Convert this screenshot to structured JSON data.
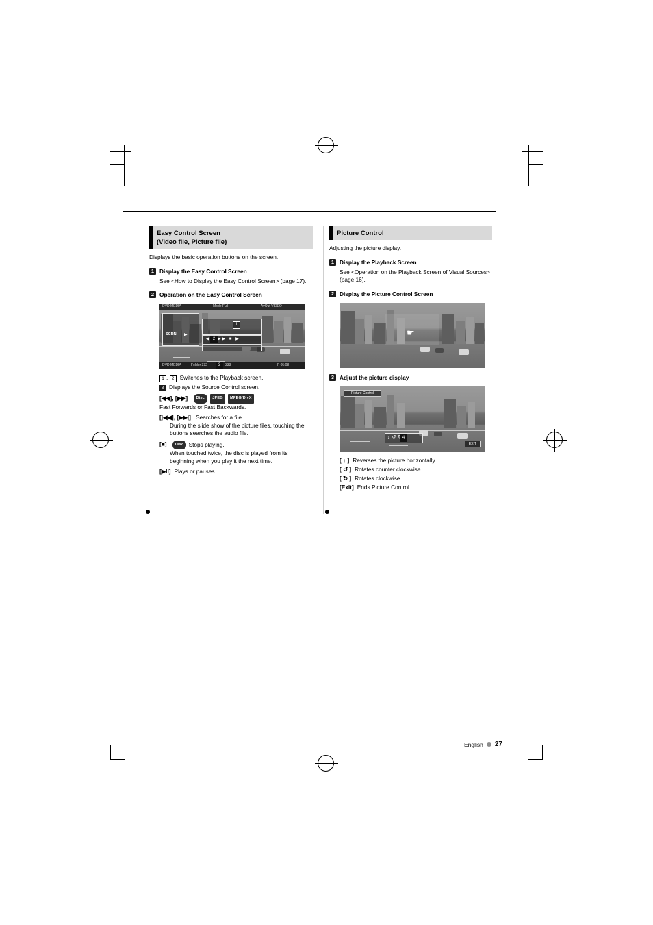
{
  "page": {
    "footer_language": "English",
    "footer_page": "27"
  },
  "left_column": {
    "heading_line1": "Easy Control Screen",
    "heading_line2": "(Video file, Picture file)",
    "intro": "Displays the basic operation buttons on the screen.",
    "step1": {
      "num": "1",
      "title": "Display the Easy Control Screen",
      "body": "See <How to Display the Easy Control Screen> (page 17)."
    },
    "step2": {
      "num": "2",
      "title": "Operation on the Easy Control Screen"
    },
    "screenshot": {
      "top_left": "DVD MEDIA",
      "top_mid": "Mode  Full",
      "top_right": "AvOut  VIDEO",
      "button_scrn": "SCRN",
      "bottom_left": "DVD MEDIA",
      "bottom_folder": "Folder 332",
      "bottom_file": "333",
      "bottom_time": "P  05:08",
      "callout_1": "1",
      "callout_2": "2",
      "callout_3": "3"
    },
    "keys": [
      {
        "tag": "1 , 2",
        "desc": "Switches to the Playback screen."
      },
      {
        "tag": "3",
        "desc": "Displays the Source Control screen."
      },
      {
        "tag": "[◀◀], [▶▶]",
        "desc": "Fast Forwards or Fast Backwards.",
        "chips": [
          "Disc",
          "JPEG",
          "MPEG/DivX"
        ]
      },
      {
        "tag": "[|◀◀], [▶▶|]",
        "desc": "Searches for a file.",
        "sub": "During the slide show of the picture files, touching the buttons searches the audio file."
      },
      {
        "tag": "[■]",
        "desc": "Stops playing.",
        "chips": [
          "Disc"
        ],
        "sub": "When touched twice, the disc is played from its beginning when you play it the next time."
      },
      {
        "tag": "[▶II]",
        "desc": "Plays or pauses."
      }
    ]
  },
  "right_column": {
    "heading": "Picture Control",
    "intro": "Adjusting the picture display.",
    "step1": {
      "num": "1",
      "title": "Display the Playback Screen",
      "body": "See <Operation on the Playback Screen of Visual Sources> (page 16)."
    },
    "step2": {
      "num": "2",
      "title": "Display the Picture Control Screen"
    },
    "step3": {
      "num": "3",
      "title": "Adjust the picture display"
    },
    "screenshot2": {
      "title_bar": "Picture Control",
      "exit_label": "EXIT",
      "callout_4": "4"
    },
    "keys": [
      {
        "tag": "[ ↕ ]",
        "desc": "Reverses the picture horizontally."
      },
      {
        "tag": "[ ↺ ]",
        "desc": "Rotates counter clockwise."
      },
      {
        "tag": "[ ↻ ]",
        "desc": "Rotates clockwise."
      },
      {
        "tag": "[Exit]",
        "desc": "Ends Picture Control."
      }
    ]
  }
}
